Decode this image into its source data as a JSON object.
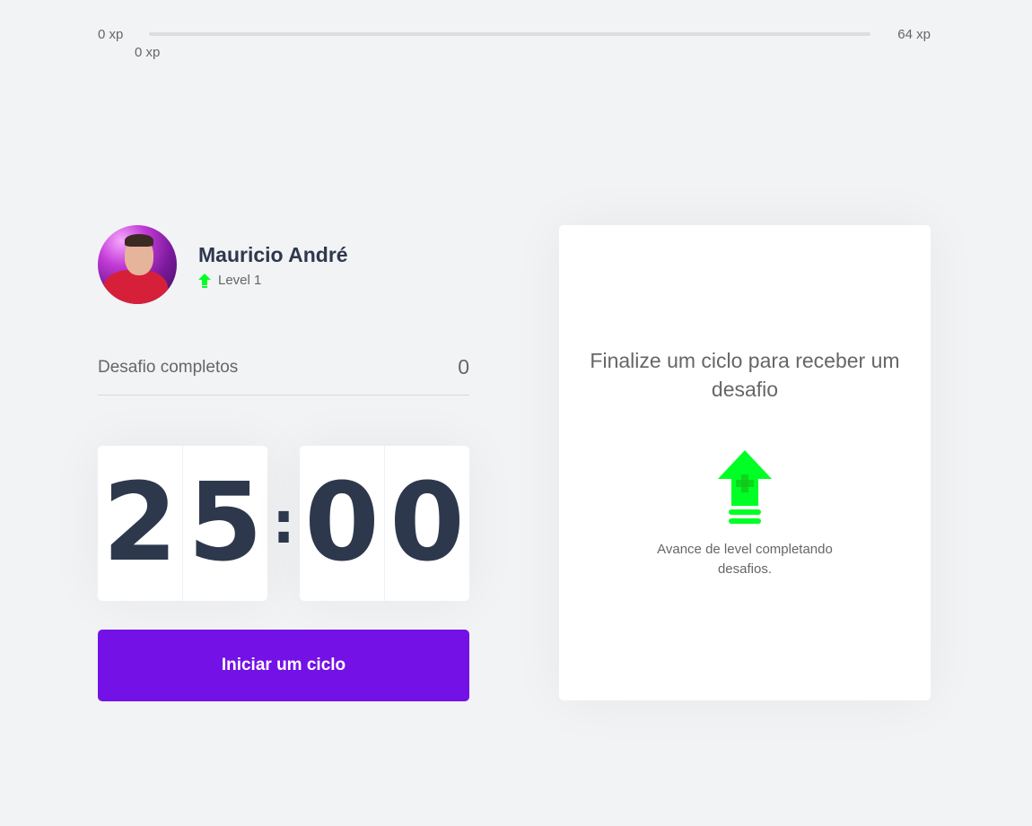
{
  "xp": {
    "min_label": "0 xp",
    "max_label": "64 xp",
    "current_label": "0 xp",
    "progress_fraction": 0
  },
  "profile": {
    "name": "Mauricio André",
    "level_label": "Level 1",
    "avatar_icon": "user-avatar-photo",
    "level_icon": "level-up-arrow-icon"
  },
  "completed": {
    "label": "Desafio completos",
    "value": "0"
  },
  "countdown": {
    "minute_left": "2",
    "minute_right": "5",
    "separator": ":",
    "second_left": "0",
    "second_right": "0"
  },
  "start_button": {
    "label": "Iniciar um ciclo"
  },
  "challenge_card": {
    "title": "Finalize um ciclo para receber um desafio",
    "icon": "level-up-icon",
    "description": "Avance de level completando desafios."
  },
  "colors": {
    "background": "#f2f3f5",
    "accent_purple": "#7411e6",
    "level_green": "#00ff25",
    "title_dark": "#2e384d",
    "text_gray": "#666666"
  }
}
